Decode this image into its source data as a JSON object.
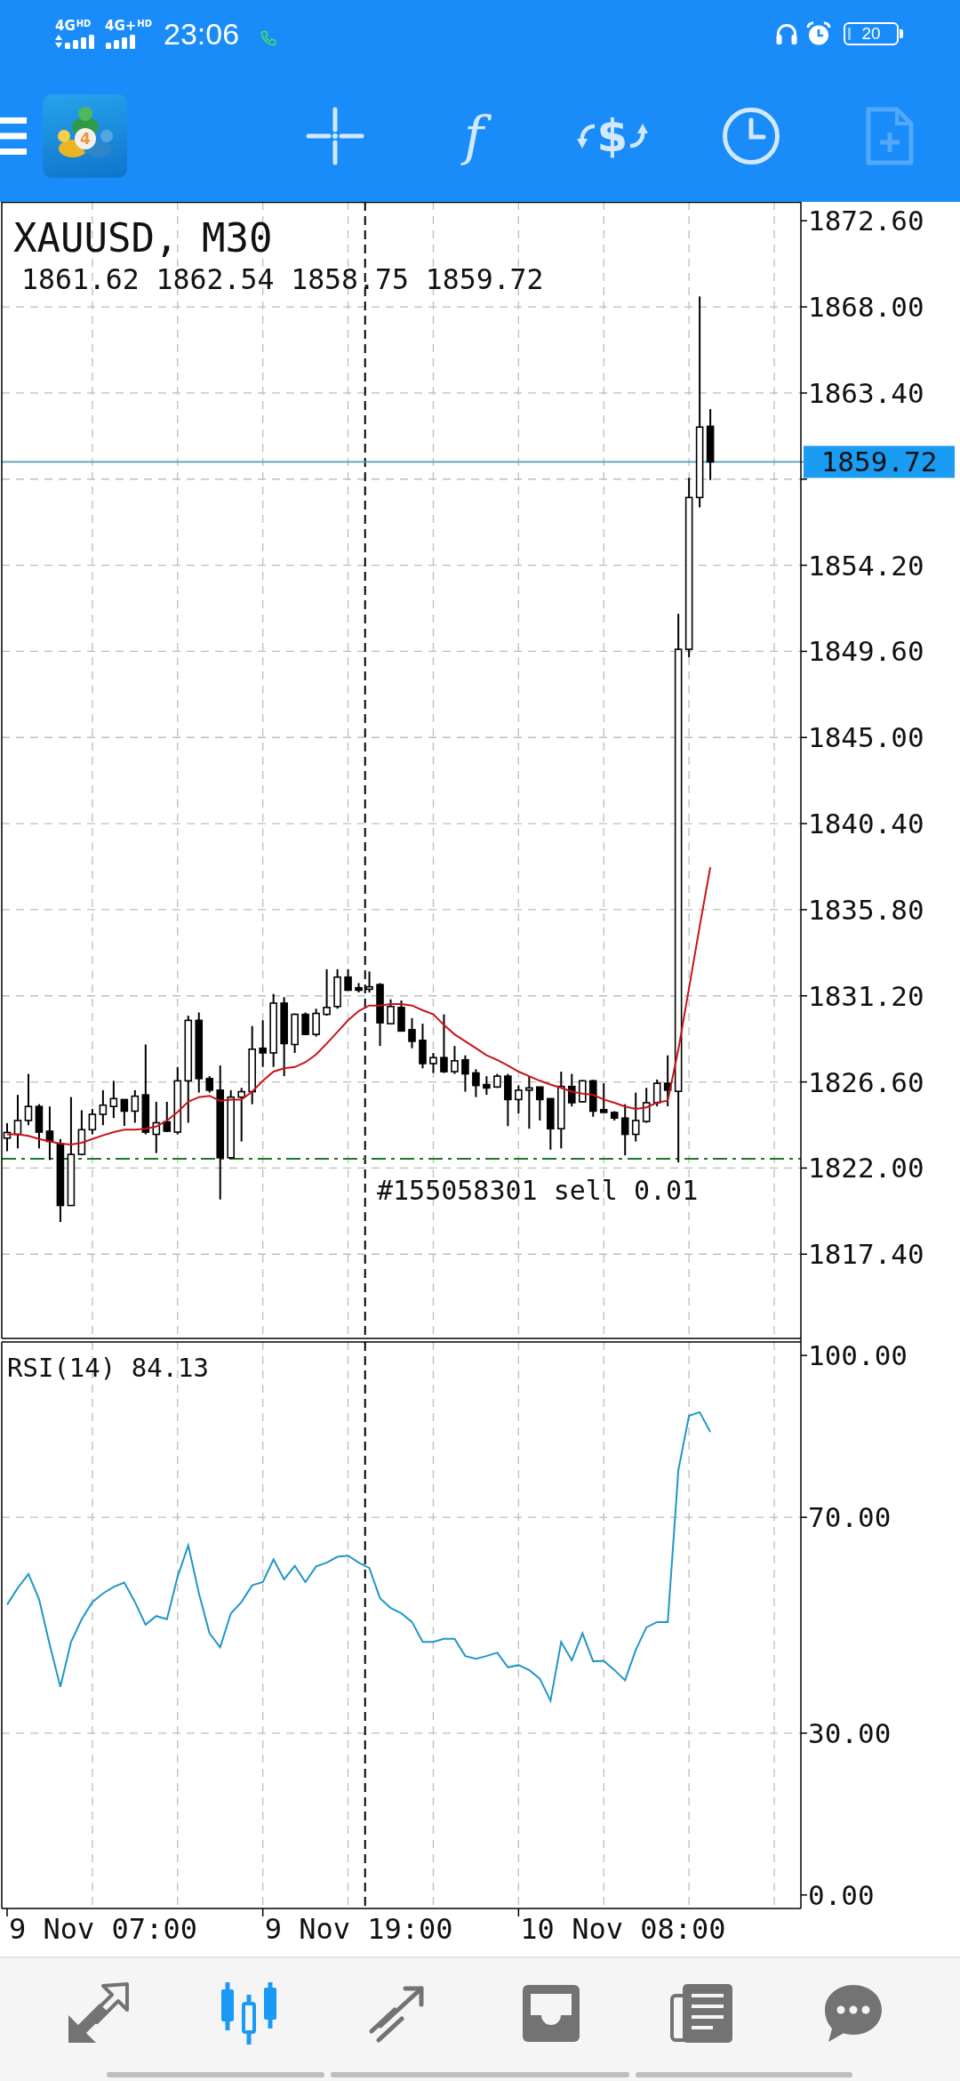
{
  "status_bar": {
    "networks": [
      {
        "label": "4G",
        "badge": "HD",
        "data": true
      },
      {
        "label": "4G+",
        "badge": "HD",
        "data": false
      }
    ],
    "time": "23:06",
    "battery": "20"
  },
  "toolbar": {
    "logo_badge": "4",
    "tools": [
      {
        "kind": "crosshair",
        "disabled": false
      },
      {
        "kind": "function",
        "label": "f",
        "disabled": false
      },
      {
        "kind": "symbol",
        "label": "$",
        "disabled": false
      },
      {
        "kind": "period",
        "disabled": false
      },
      {
        "kind": "new-order",
        "disabled": true
      }
    ]
  },
  "chart": {
    "ohlc": [
      "1861.62",
      "1862.54",
      "1858.75",
      "1859.72"
    ],
    "chart_data": {
      "type": "candlestick",
      "title": "XAUUSD, M30",
      "ohlc": [
        [
          1823.6,
          1824.4,
          1822.9,
          1823.9
        ],
        [
          1823.8,
          1825.91,
          1823.05,
          1824.54
        ],
        [
          1824.54,
          1827.03,
          1824.29,
          1825.29
        ],
        [
          1825.29,
          1825.41,
          1823.05,
          1823.92
        ],
        [
          1823.97,
          1825.29,
          1822.43,
          1823.42
        ],
        [
          1823.3,
          1823.55,
          1819.12,
          1820.0
        ],
        [
          1820.0,
          1825.79,
          1820.0,
          1822.73
        ],
        [
          1822.73,
          1825.09,
          1822.68,
          1824.05
        ],
        [
          1824.05,
          1825.16,
          1823.8,
          1824.87
        ],
        [
          1824.87,
          1826.16,
          1824.29,
          1825.36
        ],
        [
          1825.29,
          1826.66,
          1824.67,
          1825.71
        ],
        [
          1825.66,
          1825.66,
          1824.25,
          1825.04
        ],
        [
          1825.04,
          1826.16,
          1824.42,
          1825.84
        ],
        [
          1825.91,
          1828.6,
          1823.8,
          1823.92
        ],
        [
          1823.8,
          1825.54,
          1822.8,
          1824.42
        ],
        [
          1824.47,
          1825.54,
          1823.92,
          1823.97
        ],
        [
          1823.92,
          1827.4,
          1823.8,
          1826.66
        ],
        [
          1826.66,
          1830.14,
          1824.42,
          1829.89
        ],
        [
          1829.89,
          1830.31,
          1826.03,
          1826.78
        ],
        [
          1826.78,
          1826.91,
          1826.03,
          1826.16
        ],
        [
          1826.16,
          1827.48,
          1820.32,
          1822.55
        ],
        [
          1822.55,
          1826.16,
          1822.5,
          1825.79
        ],
        [
          1825.79,
          1826.28,
          1823.42,
          1826.08
        ],
        [
          1826.08,
          1829.59,
          1825.41,
          1828.35
        ],
        [
          1828.4,
          1829.89,
          1827.4,
          1828.15
        ],
        [
          1828.15,
          1831.3,
          1827.4,
          1830.81
        ],
        [
          1830.81,
          1831.13,
          1826.91,
          1828.65
        ],
        [
          1828.6,
          1830.26,
          1828.15,
          1830.21
        ],
        [
          1830.21,
          1830.31,
          1829.14,
          1829.14
        ],
        [
          1829.14,
          1830.51,
          1829.02,
          1830.26
        ],
        [
          1830.21,
          1832.62,
          1830.14,
          1830.58
        ],
        [
          1830.63,
          1832.62,
          1830.51,
          1832.2
        ],
        [
          1832.2,
          1832.62,
          1831.5,
          1831.5
        ],
        [
          1831.63,
          1831.88,
          1831.38,
          1831.5
        ],
        [
          1831.55,
          1832.5,
          1831.38,
          1831.68
        ],
        [
          1831.8,
          1831.88,
          1828.52,
          1829.76
        ],
        [
          1829.71,
          1831.01,
          1829.71,
          1830.63
        ],
        [
          1830.58,
          1830.95,
          1829.32,
          1829.32
        ],
        [
          1829.39,
          1830.01,
          1828.4,
          1828.77
        ],
        [
          1828.82,
          1829.71,
          1827.33,
          1827.58
        ],
        [
          1827.58,
          1828.15,
          1827.08,
          1827.9
        ],
        [
          1827.9,
          1830.21,
          1827.08,
          1827.15
        ],
        [
          1827.15,
          1828.52,
          1827.03,
          1827.73
        ],
        [
          1827.78,
          1828.02,
          1826.08,
          1827.03
        ],
        [
          1827.08,
          1827.28,
          1825.79,
          1826.41
        ],
        [
          1826.46,
          1826.91,
          1825.91,
          1826.28
        ],
        [
          1826.33,
          1827.03,
          1826.28,
          1826.91
        ],
        [
          1826.91,
          1827.03,
          1824.24,
          1825.66
        ],
        [
          1825.66,
          1826.41,
          1824.92,
          1826.16
        ],
        [
          1826.16,
          1826.91,
          1824.1,
          1826.28
        ],
        [
          1826.33,
          1826.33,
          1824.54,
          1825.66
        ],
        [
          1825.71,
          1825.71,
          1822.98,
          1824.1
        ],
        [
          1824.1,
          1827.15,
          1823.05,
          1826.36
        ],
        [
          1826.36,
          1827.03,
          1825.29,
          1825.49
        ],
        [
          1825.54,
          1826.71,
          1825.49,
          1826.66
        ],
        [
          1826.66,
          1826.71,
          1824.74,
          1825.04
        ],
        [
          1825.12,
          1826.53,
          1824.97,
          1824.97
        ],
        [
          1824.97,
          1825.04,
          1824.54,
          1824.67
        ],
        [
          1824.67,
          1825.41,
          1822.68,
          1823.8
        ],
        [
          1823.8,
          1826.03,
          1823.42,
          1824.54
        ],
        [
          1824.49,
          1826.28,
          1824.42,
          1825.49
        ],
        [
          1825.49,
          1826.73,
          1825.3,
          1826.53
        ],
        [
          1826.53,
          1828.02,
          1825.3,
          1826.16
        ],
        [
          1826.1,
          1851.6,
          1822.3,
          1849.71
        ],
        [
          1849.71,
          1858.87,
          1849.29,
          1857.82
        ],
        [
          1857.82,
          1868.56,
          1857.29,
          1861.58
        ],
        [
          1861.62,
          1862.54,
          1858.75,
          1859.72
        ],
        null,
        null,
        null,
        null,
        null,
        null,
        null,
        null
      ],
      "series": [
        {
          "type": "line",
          "color": "#c8121c",
          "values": [
            1823.8,
            1823.8,
            1823.72,
            1823.55,
            1823.42,
            1823.3,
            1823.25,
            1823.35,
            1823.55,
            1823.75,
            1823.92,
            1824.05,
            1824.05,
            1824.1,
            1824.22,
            1824.54,
            1824.99,
            1825.54,
            1825.79,
            1825.86,
            1825.59,
            1825.66,
            1825.66,
            1826.08,
            1826.66,
            1827.15,
            1827.33,
            1827.4,
            1827.65,
            1828.07,
            1828.65,
            1829.27,
            1829.89,
            1830.39,
            1830.68,
            1830.68,
            1830.76,
            1830.76,
            1830.68,
            1830.43,
            1830.21,
            1829.64,
            1829.14,
            1828.77,
            1828.4,
            1828.02,
            1827.78,
            1827.48,
            1827.15,
            1826.91,
            1826.66,
            1826.46,
            1826.28,
            1826.08,
            1825.98,
            1825.91,
            1825.66,
            1825.49,
            1825.29,
            1825.16,
            1825.24,
            1825.5,
            1825.6,
            1828.35,
            1831.6,
            1834.9,
            1838.07,
            null,
            null,
            null,
            null,
            null,
            null,
            null,
            null
          ]
        }
      ],
      "ylim": [
        1812.9,
        1873.61
      ],
      "yticks": [
        {
          "value": 1872.6,
          "label": "1872.60"
        },
        {
          "value": 1868,
          "label": "1868.00"
        },
        {
          "value": 1863.4,
          "label": "1863.40"
        },
        {
          "value": 1854.2,
          "label": "1854.20"
        },
        {
          "value": 1849.6,
          "label": "1849.60"
        },
        {
          "value": 1845,
          "label": "1845.00"
        },
        {
          "value": 1840.4,
          "label": "1840.40"
        },
        {
          "value": 1835.8,
          "label": "1835.80"
        },
        {
          "value": 1831.2,
          "label": "1831.20"
        },
        {
          "value": 1826.6,
          "label": "1826.60"
        },
        {
          "value": 1822,
          "label": "1822.00"
        },
        {
          "value": 1817.4,
          "label": "1817.40"
        }
      ],
      "grid": true,
      "ref_lines": [
        {
          "axis": "y",
          "value": 1822.5,
          "color": "#1b7a1b",
          "label": "#155058301 sell 0.01"
        },
        {
          "axis": "y",
          "value": 1859.72,
          "color": "#4aa0b8",
          "label": "1859.72"
        }
      ]
    }
  },
  "rsi": {
    "chart_data": {
      "type": "line",
      "title": "RSI(14) 84.13",
      "series": [
        {
          "color": "#2196c8",
          "values": [
            53.8,
            56.9,
            59.5,
            54.8,
            46.4,
            38.6,
            46.9,
            51.1,
            54.3,
            55.9,
            57.1,
            57.9,
            54.3,
            50.1,
            51.7,
            51.1,
            59.0,
            64.8,
            55.9,
            48.5,
            45.9,
            52.2,
            54.3,
            57.4,
            58.0,
            62.2,
            58.5,
            61.0,
            58.0,
            60.9,
            61.6,
            62.7,
            62.9,
            61.6,
            60.6,
            55.0,
            53.2,
            52.2,
            50.6,
            46.9,
            46.9,
            47.5,
            47.5,
            44.3,
            43.8,
            44.3,
            44.9,
            42.2,
            42.6,
            41.7,
            40.1,
            36.0,
            46.9,
            43.5,
            48.5,
            43.3,
            43.4,
            41.7,
            39.8,
            45.4,
            49.6,
            50.6,
            50.6,
            78.8,
            88.8,
            89.5,
            85.8,
            null,
            null,
            null,
            null,
            null,
            null,
            null,
            null
          ]
        }
      ],
      "ylim": [
        -2.5,
        102.5
      ],
      "yticks": [
        {
          "value": 100,
          "label": "100.00"
        },
        {
          "value": 70,
          "label": "70.00"
        },
        {
          "value": 30,
          "label": "30.00"
        },
        {
          "value": 0,
          "label": "0.00"
        }
      ],
      "grid": true
    },
    "time_axis": [
      "9 Nov 07:00",
      "9 Nov 19:00",
      "10 Nov 08:00"
    ]
  },
  "bottom_nav": {
    "items": [
      {
        "kind": "quotes",
        "selected": false
      },
      {
        "kind": "chart",
        "selected": true
      },
      {
        "kind": "trade",
        "selected": false
      },
      {
        "kind": "history",
        "selected": false
      },
      {
        "kind": "news",
        "selected": false
      },
      {
        "kind": "chat",
        "selected": false
      }
    ]
  }
}
